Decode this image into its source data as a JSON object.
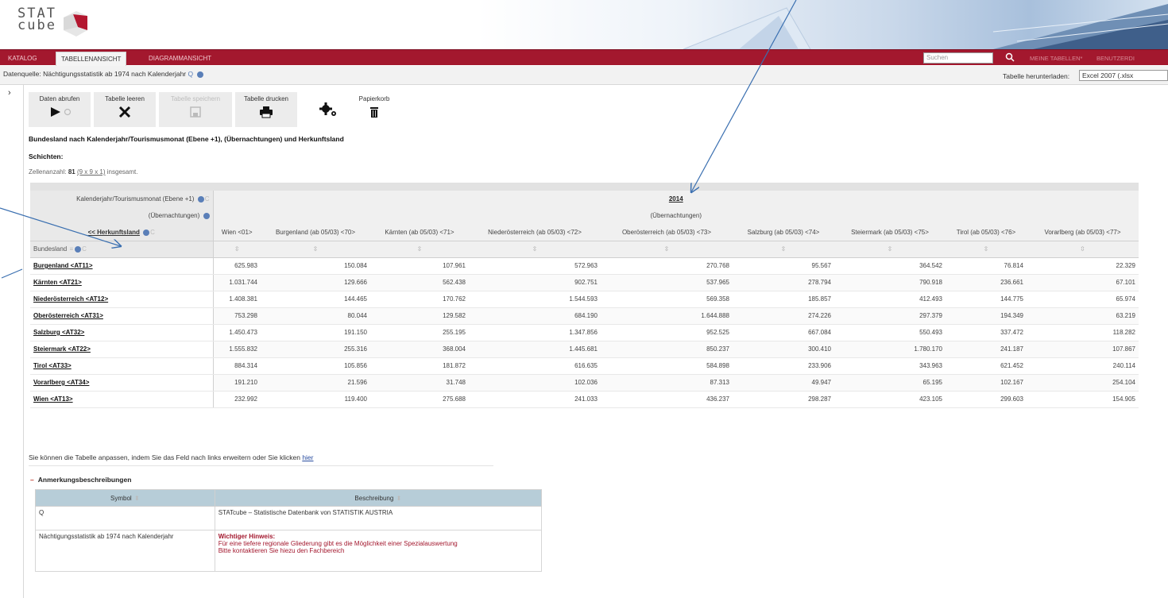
{
  "app": {
    "logo_line1": "STAT",
    "logo_line2": "cube"
  },
  "nav": {
    "tabs": [
      {
        "label": "KATALOG"
      },
      {
        "label": "TABELLENANSICHT"
      },
      {
        "label": "DIAGRAMMANSICHT"
      }
    ],
    "search_placeholder": "Suchen",
    "meine_tabellen": "MEINE TABELLEN*",
    "benutzer": "BENUTZERDI"
  },
  "quelle": {
    "text": "Datenquelle: Nächtigungsstatistik ab 1974 nach Kalenderjahr",
    "download_label": "Tabelle herunterladen:",
    "download_value": "Excel 2007 (.xlsx"
  },
  "toolbar": {
    "daten_abrufen": "Daten abrufen",
    "tabelle_leeren": "Tabelle leeren",
    "tabelle_speichern": "Tabelle speichern",
    "tabelle_drucken": "Tabelle drucken",
    "papierkorb": "Papierkorb"
  },
  "table_title": "Bundesland nach Kalenderjahr/Tourismusmonat (Ebene +1), (Übernachtungen) und Herkunftsland",
  "schichten": "Schichten:",
  "zellen": {
    "prefix": "Zellenanzahl:",
    "count": "81",
    "dims": "(9 x 9 x 1)",
    "suffix": "insgesamt."
  },
  "pivot": {
    "row1_label": "Kalenderjahr/Tourismusmonat (Ebene +1)",
    "year": "2014",
    "row2_label": "(Übernachtungen)",
    "measure": "(Übernachtungen)",
    "row3_label": "<< Herkunftsland",
    "row_dim_label": "Bundesland",
    "columns": [
      "Wien <01>",
      "Burgenland (ab 05/03) <70>",
      "Kärnten (ab 05/03) <71>",
      "Niederösterreich (ab 05/03) <72>",
      "Oberösterreich (ab 05/03) <73>",
      "Salzburg (ab 05/03) <74>",
      "Steiermark (ab 05/03) <75>",
      "Tirol (ab 05/03) <76>",
      "Vorarlberg (ab 05/03) <77>"
    ],
    "rows": [
      {
        "name": "Burgenland <AT11>",
        "values": [
          "625.983",
          "150.084",
          "107.961",
          "572.963",
          "270.768",
          "95.567",
          "364.542",
          "76.814",
          "22.329"
        ]
      },
      {
        "name": "Kärnten <AT21>",
        "values": [
          "1.031.744",
          "129.666",
          "562.438",
          "902.751",
          "537.965",
          "278.794",
          "790.918",
          "236.661",
          "67.101"
        ]
      },
      {
        "name": "Niederösterreich <AT12>",
        "values": [
          "1.408.381",
          "144.465",
          "170.762",
          "1.544.593",
          "569.358",
          "185.857",
          "412.493",
          "144.775",
          "65.974"
        ]
      },
      {
        "name": "Oberösterreich <AT31>",
        "values": [
          "753.298",
          "80.044",
          "129.582",
          "684.190",
          "1.644.888",
          "274.226",
          "297.379",
          "194.349",
          "63.219"
        ]
      },
      {
        "name": "Salzburg <AT32>",
        "values": [
          "1.450.473",
          "191.150",
          "255.195",
          "1.347.856",
          "952.525",
          "667.084",
          "550.493",
          "337.472",
          "118.282"
        ]
      },
      {
        "name": "Steiermark <AT22>",
        "values": [
          "1.555.832",
          "255.316",
          "368.004",
          "1.445.681",
          "850.237",
          "300.410",
          "1.780.170",
          "241.187",
          "107.867"
        ]
      },
      {
        "name": "Tirol <AT33>",
        "values": [
          "884.314",
          "105.856",
          "181.872",
          "616.635",
          "584.898",
          "233.906",
          "343.963",
          "621.452",
          "240.114"
        ]
      },
      {
        "name": "Vorarlberg <AT34>",
        "values": [
          "191.210",
          "21.596",
          "31.748",
          "102.036",
          "87.313",
          "49.947",
          "65.195",
          "102.167",
          "254.104"
        ]
      },
      {
        "name": "Wien <AT13>",
        "values": [
          "232.992",
          "119.400",
          "275.688",
          "241.033",
          "436.237",
          "298.287",
          "423.105",
          "299.603",
          "154.905"
        ]
      }
    ]
  },
  "hint": {
    "text": "Sie können die Tabelle anpassen, indem Sie das Feld nach links erweitern oder Sie klicken",
    "link": "hier"
  },
  "anmerkungen": {
    "toggle": "–",
    "title": "Anmerkungsbeschreibungen",
    "col_symbol": "Symbol",
    "col_beschreibung": "Beschreibung",
    "rows": [
      {
        "symbol": "Q",
        "beschreibung": "STATcube – Statistische Datenbank von STATISTIK AUSTRIA"
      },
      {
        "symbol": "Nächtigungsstatistik ab 1974 nach Kalenderjahr",
        "hinweis_title": "Wichtiger Hinweis:",
        "hinweis_line1": "Für eine tiefere regionale Gliederung gibt es die Möglichkeit einer Spezialauswertung",
        "hinweis_line2": "Bitte kontaktieren Sie hiezu den Fachbereich"
      }
    ]
  },
  "colors": {
    "brand_red": "#a3182e",
    "annotation_arrow": "#3a6fb0"
  },
  "icons": [
    "play-icon",
    "refresh-icon",
    "close-x-icon",
    "save-disk-icon",
    "printer-icon",
    "settings-gears-icon",
    "trash-icon",
    "search-icon",
    "info-icon",
    "sort-icon"
  ]
}
